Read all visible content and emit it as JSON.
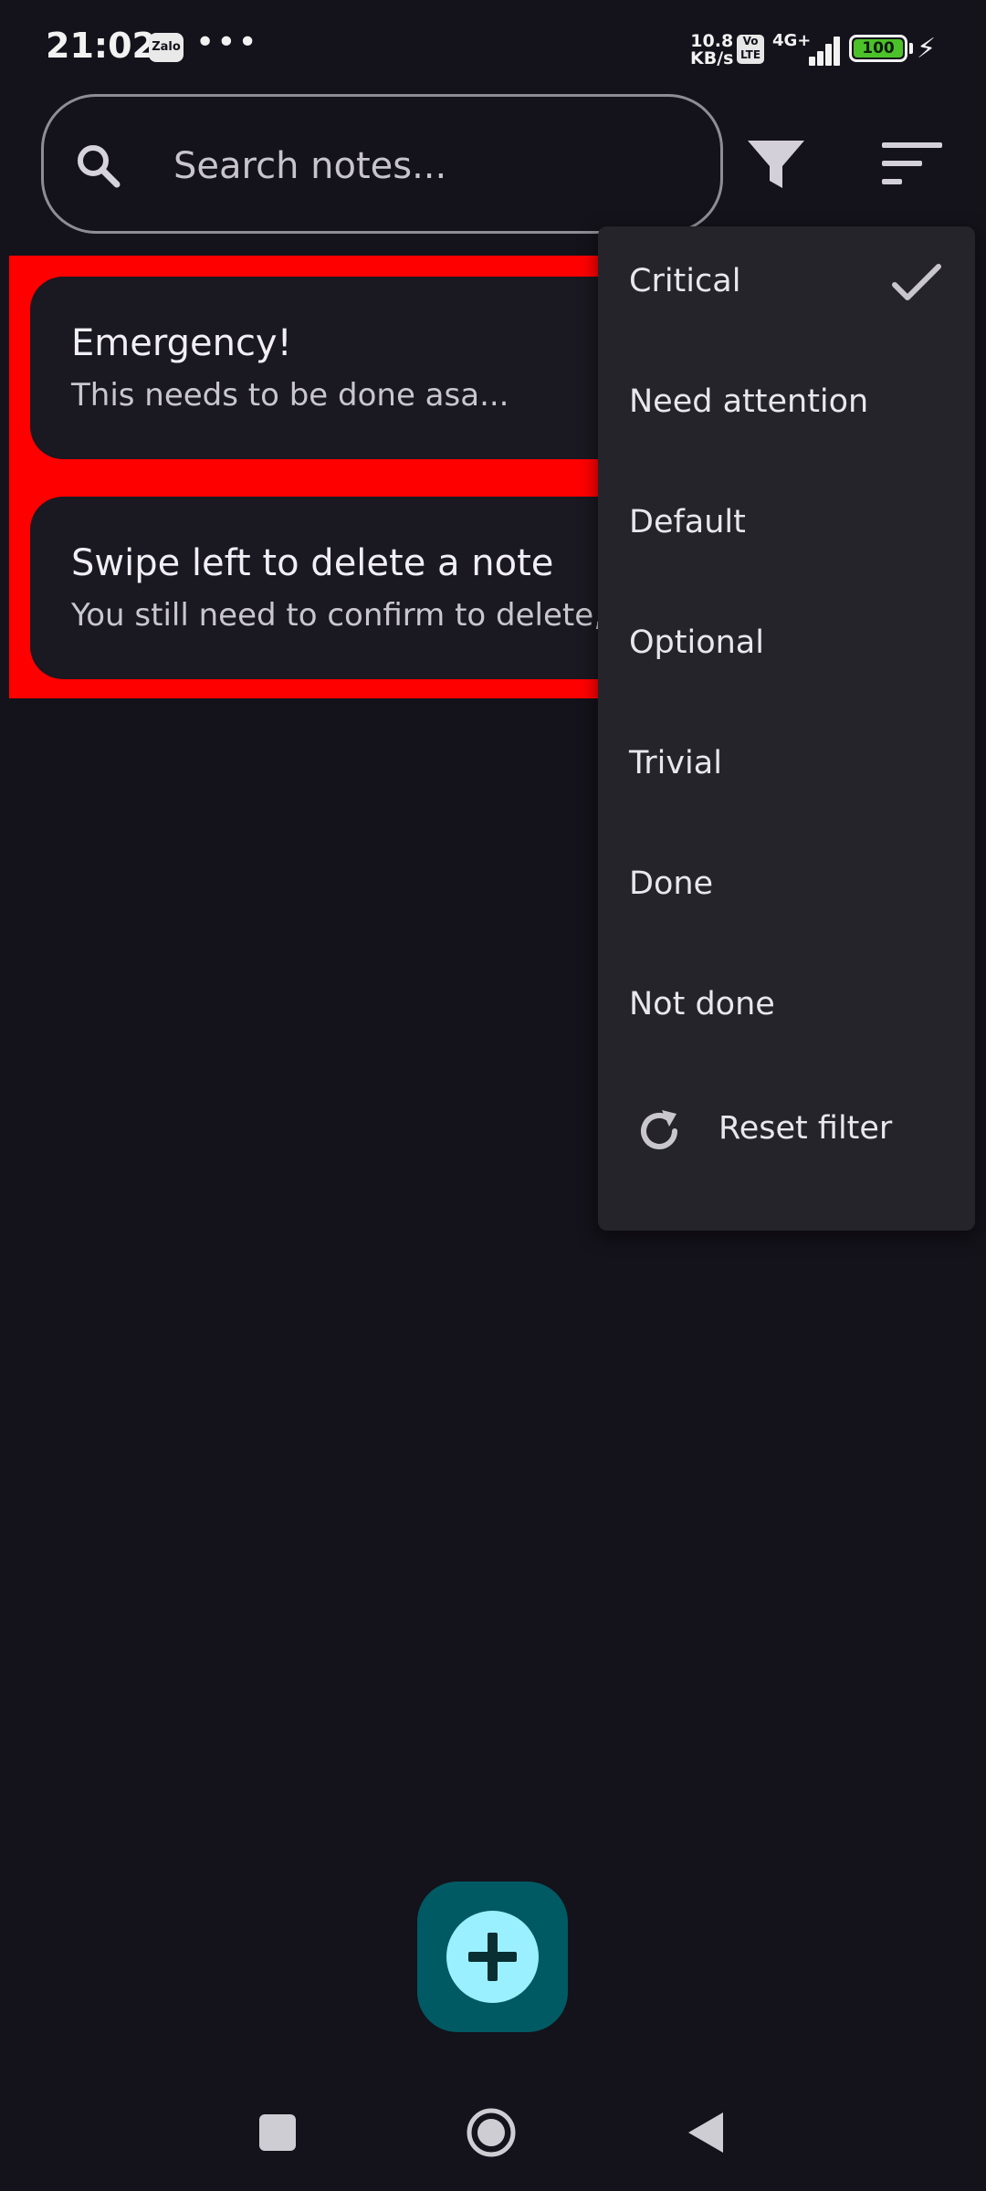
{
  "status_bar": {
    "time": "21:02",
    "zalo_label": "Zalo",
    "more": "•••",
    "net_speed_value": "10.8",
    "net_speed_unit": "KB/s",
    "volte": "Vo\nLTE",
    "network_type": "4G+",
    "battery": "100"
  },
  "search": {
    "placeholder": "Search notes..."
  },
  "notes": [
    {
      "title": "Emergency!",
      "body": "This needs to be done asa..."
    },
    {
      "title": "Swipe left to delete a note",
      "body": "You still need to confirm to delete,"
    }
  ],
  "filter_menu": {
    "items": [
      {
        "label": "Critical",
        "checked": true
      },
      {
        "label": "Need attention",
        "checked": false
      },
      {
        "label": "Default",
        "checked": false
      },
      {
        "label": "Optional",
        "checked": false
      },
      {
        "label": "Trivial",
        "checked": false
      },
      {
        "label": "Done",
        "checked": false
      },
      {
        "label": "Not done",
        "checked": false
      }
    ],
    "reset_label": "Reset filter"
  },
  "colors": {
    "background": "#14121a",
    "swipe_delete_bg": "#ff0000",
    "card_bg": "#1a1820",
    "menu_bg": "#25242b",
    "fab_bg": "#005a63",
    "fab_icon_bg": "#9bf0ff",
    "battery_fill": "#4cc12a"
  },
  "icons": {
    "search": "search-icon",
    "filter": "filter-funnel-icon",
    "sort": "sort-lines-icon",
    "check": "check-icon",
    "reset": "refresh-icon",
    "add": "plus-icon"
  }
}
